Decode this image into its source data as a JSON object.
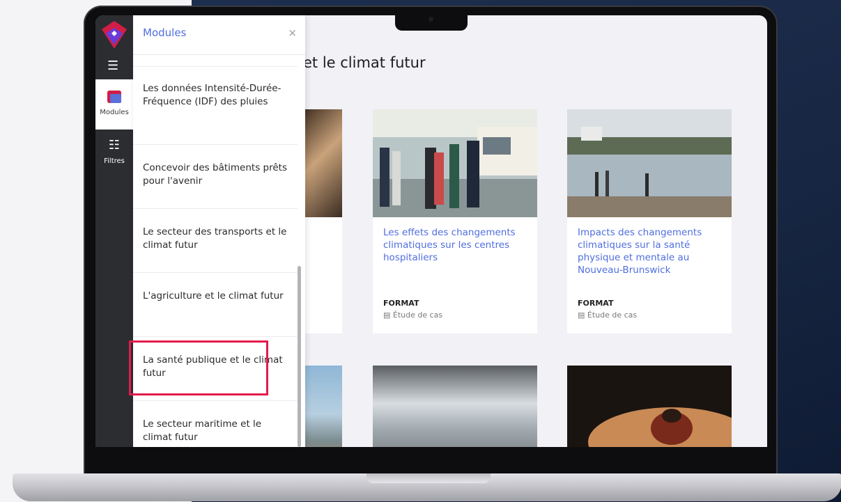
{
  "panel": {
    "title": "Modules",
    "close_glyph": "×",
    "items": [
      "Les données Intensité-Durée-Fréquence (IDF) des pluies",
      "Concevoir des bâtiments prêts pour l'avenir",
      "Le secteur des transports et le climat futur",
      "L'agriculture et le climat futur",
      "La santé publique et le climat futur",
      "Le secteur maritime et le climat futur"
    ]
  },
  "rail": {
    "menu_icon": "menu-icon",
    "modules_label": "Modules",
    "filters_label": "Filtres"
  },
  "main": {
    "heading": "et le climat futur",
    "cards": [
      {
        "title": "Les effets des changements climatiques sur les centres hospitaliers",
        "format_label": "FORMAT",
        "format_value": "Étude de cas"
      },
      {
        "title": "Impacts des changements climatiques sur la santé physique et mentale au Nouveau-Brunswick",
        "format_label": "FORMAT",
        "format_value": "Étude de cas"
      }
    ]
  },
  "colors": {
    "accent": "#4f6ee0",
    "highlight": "#e31b4c",
    "rail": "#2b2d31"
  }
}
